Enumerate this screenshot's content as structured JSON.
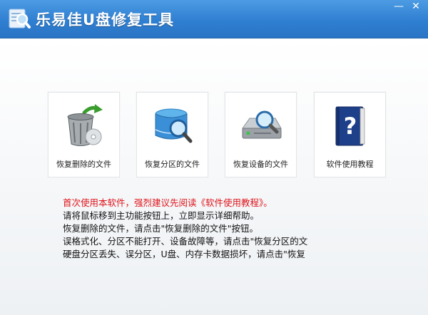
{
  "window": {
    "title": "乐易佳U盘修复工具",
    "minimize_glyph": "—",
    "close_glyph": "✕",
    "accent_color": "#2f7fd2"
  },
  "tiles": [
    {
      "label": "恢复删除的文件",
      "icon": "recycle-bin-icon"
    },
    {
      "label": "恢复分区的文件",
      "icon": "disk-magnifier-icon"
    },
    {
      "label": "恢复设备的文件",
      "icon": "drive-magnifier-icon"
    },
    {
      "label": "软件使用教程",
      "icon": "help-book-icon"
    }
  ],
  "help": {
    "lines": [
      "首次使用本软件，强烈建议先阅读《软件使用教程》。",
      "请将鼠标移到主功能按钮上，立即显示详细帮助。",
      "恢复删除的文件，请点击\"恢复删除的文件\"按钮。",
      "误格式化、分区不能打开、设备故障等，请点击\"恢复分区的文",
      "硬盘分区丢失、误分区，U盘、内存卡数据损坏，请点击\"恢复"
    ],
    "highlight_color": "#e0141a"
  }
}
